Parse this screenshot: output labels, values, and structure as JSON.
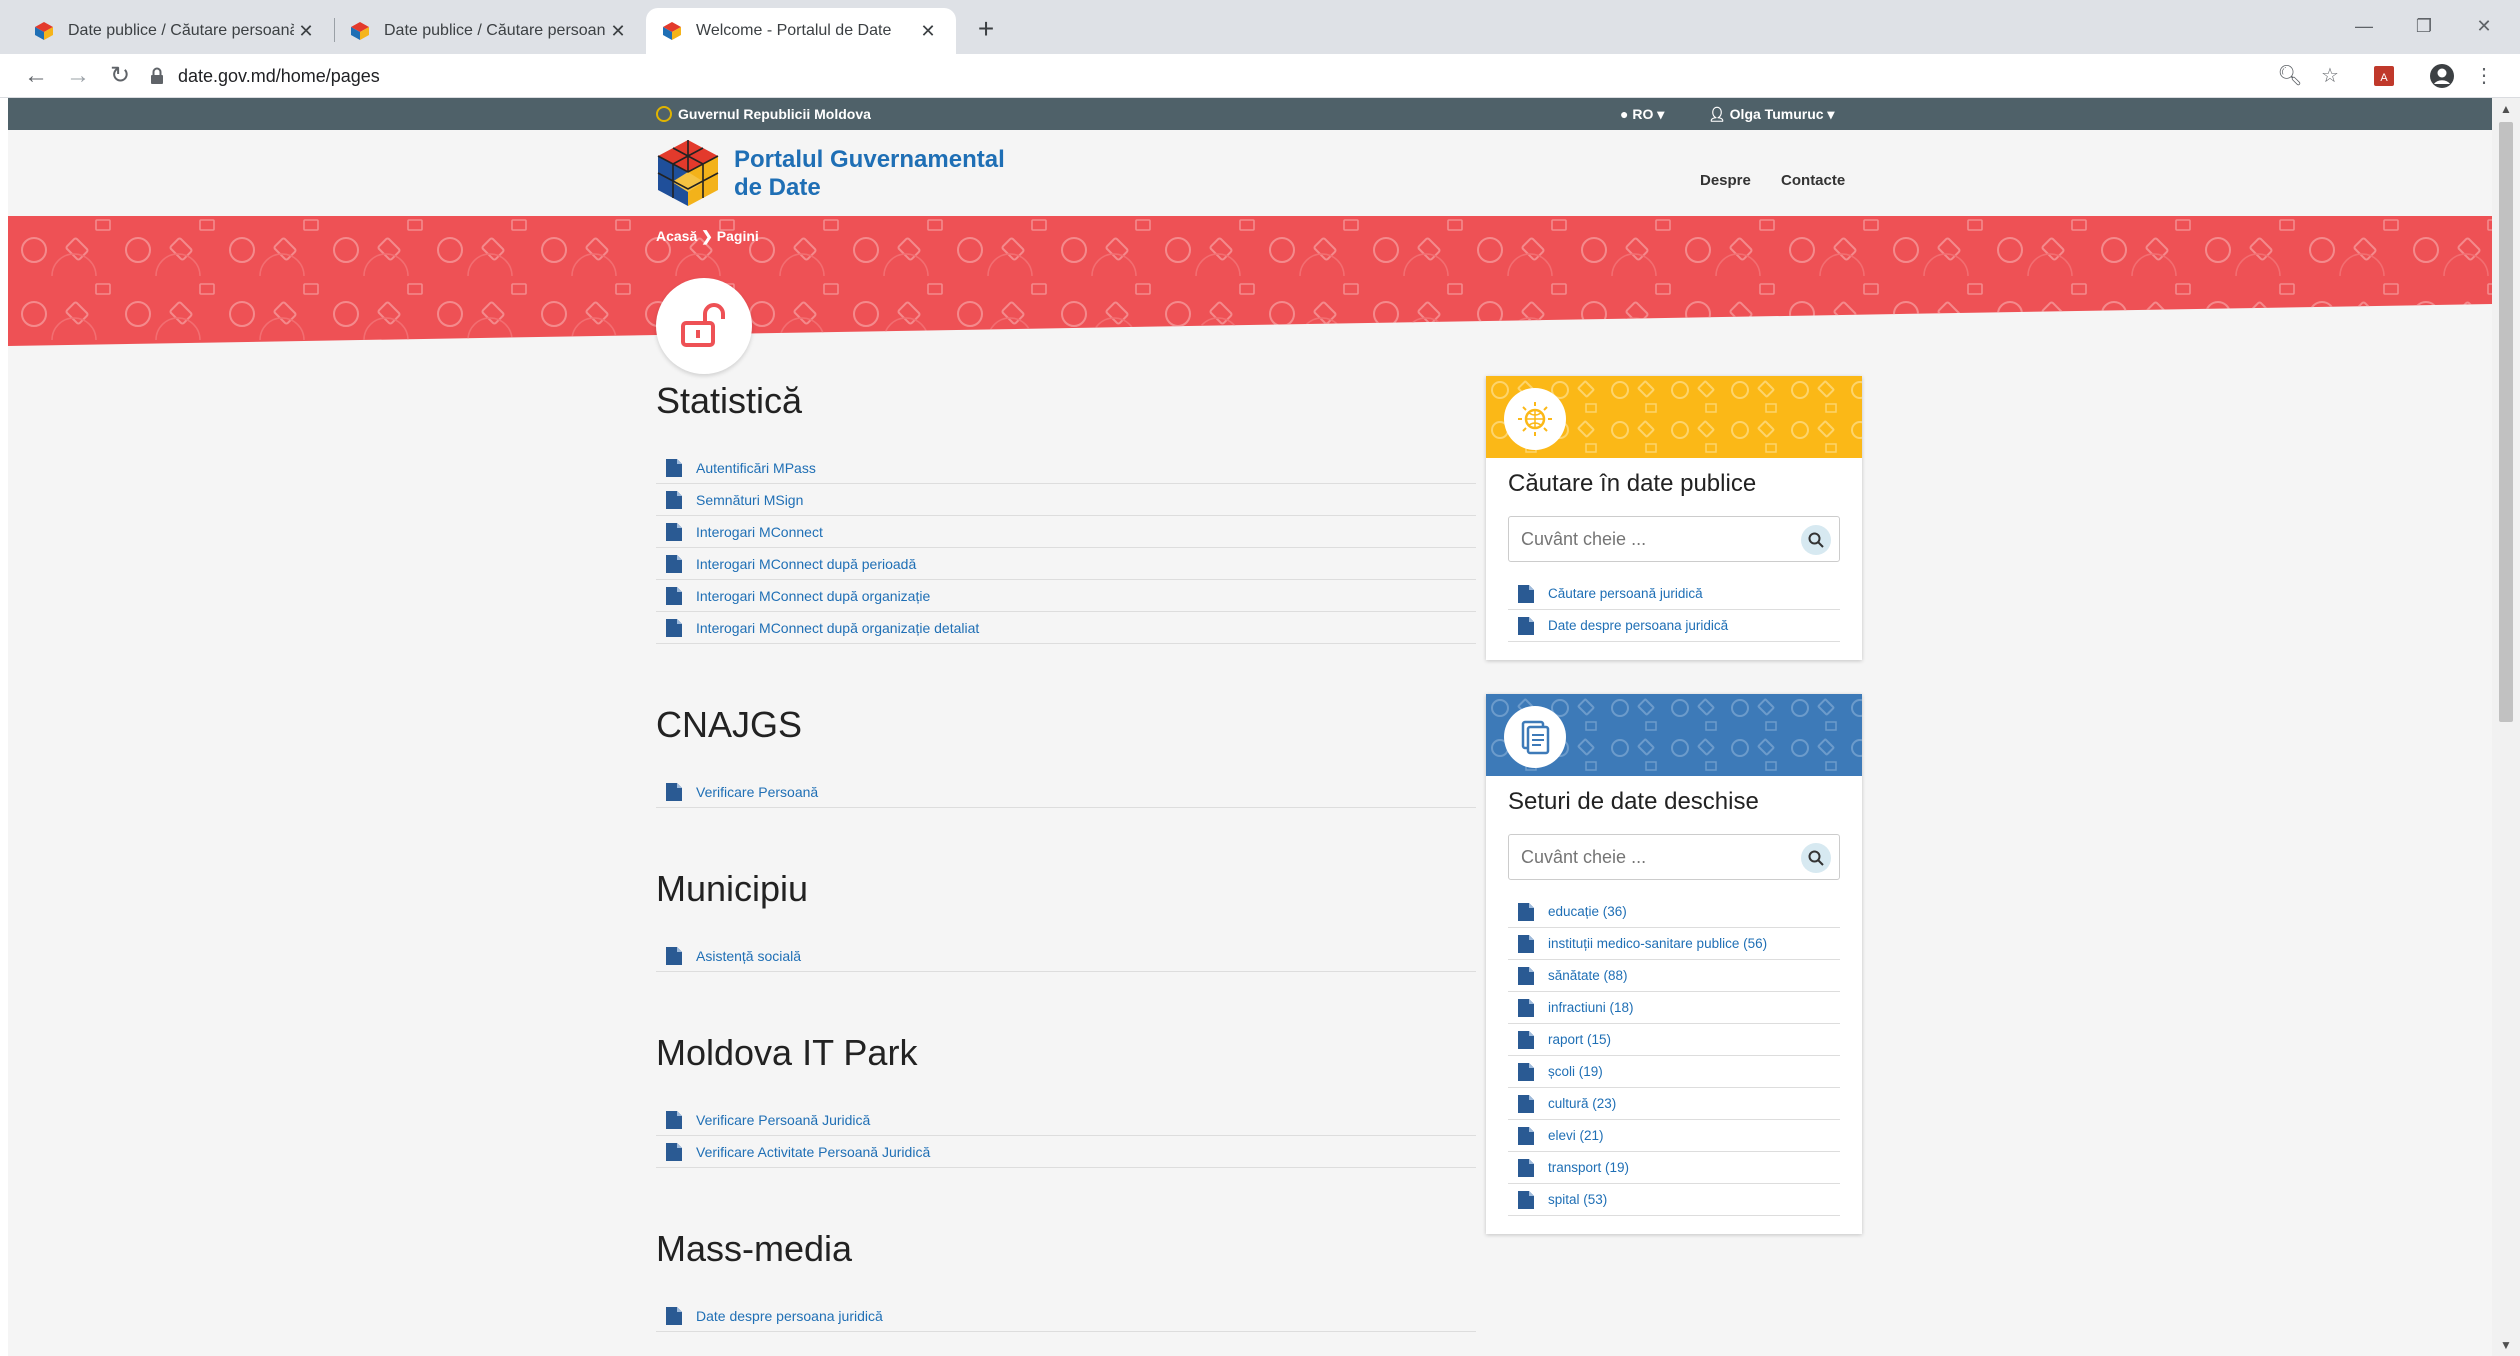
{
  "browser": {
    "tabs": [
      {
        "title": "Date publice / Căutare persoană",
        "active": false
      },
      {
        "title": "Date publice / Căutare persoană",
        "active": false
      },
      {
        "title": "Welcome - Portalul de Date",
        "active": true
      }
    ],
    "url": "date.gov.md/home/pages"
  },
  "gov_bar": {
    "name": "Guvernul Republicii Moldova",
    "language": "RO",
    "user": "Olga Tumuruc"
  },
  "header": {
    "title_line1": "Portalul Guvernamental",
    "title_line2": "de Date",
    "nav": [
      "Despre",
      "Contacte"
    ]
  },
  "breadcrumb": {
    "home": "Acasă",
    "current": "Pagini"
  },
  "sections": [
    {
      "title": "Statistică",
      "links": [
        "Autentificări MPass",
        "Semnături MSign",
        "Interogari MConnect",
        "Interogari MConnect după perioadă",
        "Interogari MConnect după organizație",
        "Interogari MConnect după organizație detaliat"
      ]
    },
    {
      "title": "CNAJGS",
      "links": [
        "Verificare Persoană"
      ]
    },
    {
      "title": "Municipiu",
      "links": [
        "Asistență socială"
      ]
    },
    {
      "title": "Moldova IT Park",
      "links": [
        "Verificare Persoană Juridică",
        "Verificare Activitate Persoană Juridică"
      ]
    },
    {
      "title": "Mass-media",
      "links": [
        "Date despre persoana juridică"
      ]
    }
  ],
  "search_widget": {
    "title": "Căutare în date publice",
    "placeholder": "Cuvânt cheie ...",
    "links": [
      "Căutare persoană juridică",
      "Date despre persoana juridică"
    ],
    "banner_color": "#fbb817"
  },
  "datasets_widget": {
    "title": "Seturi de date deschise",
    "placeholder": "Cuvânt cheie ...",
    "links": [
      "educație (36)",
      "instituții medico-sanitare publice (56)",
      "sănătate (88)",
      "infractiuni (18)",
      "raport (15)",
      "școli (19)",
      "cultură (23)",
      "elevi (21)",
      "transport (19)",
      "spital (53)"
    ],
    "banner_color": "#3d7ab8"
  },
  "colors": {
    "banner_red": "#ee5155",
    "link_blue": "#1f6fb5",
    "gov_bar": "#4f6169"
  }
}
